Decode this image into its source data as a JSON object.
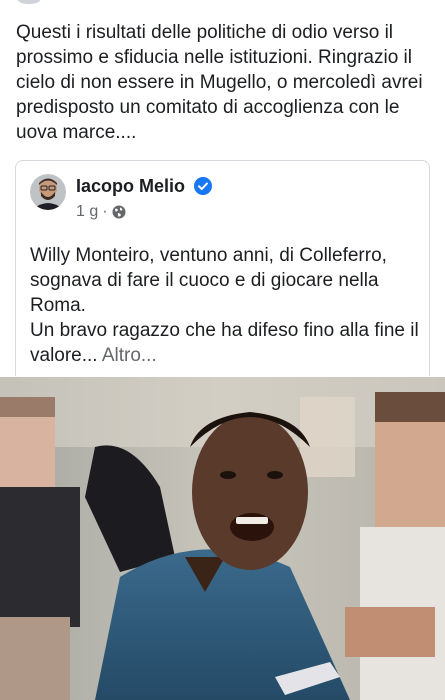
{
  "post": {
    "text": "Questi i risultati delle politiche di odio verso il prossimo e sfiducia nelle istituzioni. Ringrazio il cielo di non essere in Mugello, o mercoledì avrei predisposto un comitato di accoglienza con le uova marce...."
  },
  "shared_post": {
    "author": "Iacopo Melio",
    "time": "1 g",
    "separator": "·",
    "text_line1": "Willy Monteiro, ventuno anni, di Colleferro, sognava di fare il cuoco e di giocare nella Roma.",
    "text_line2": "Un bravo ragazzo che ha difeso fino alla fine il valore...",
    "more_label": "Altro...",
    "icons": {
      "verified": "verified-badge-icon",
      "audience": "globe-icon"
    }
  },
  "colors": {
    "text": "#1c1e21",
    "secondary": "#65676b",
    "verified": "#1877f2",
    "border": "#d6d9dd"
  }
}
